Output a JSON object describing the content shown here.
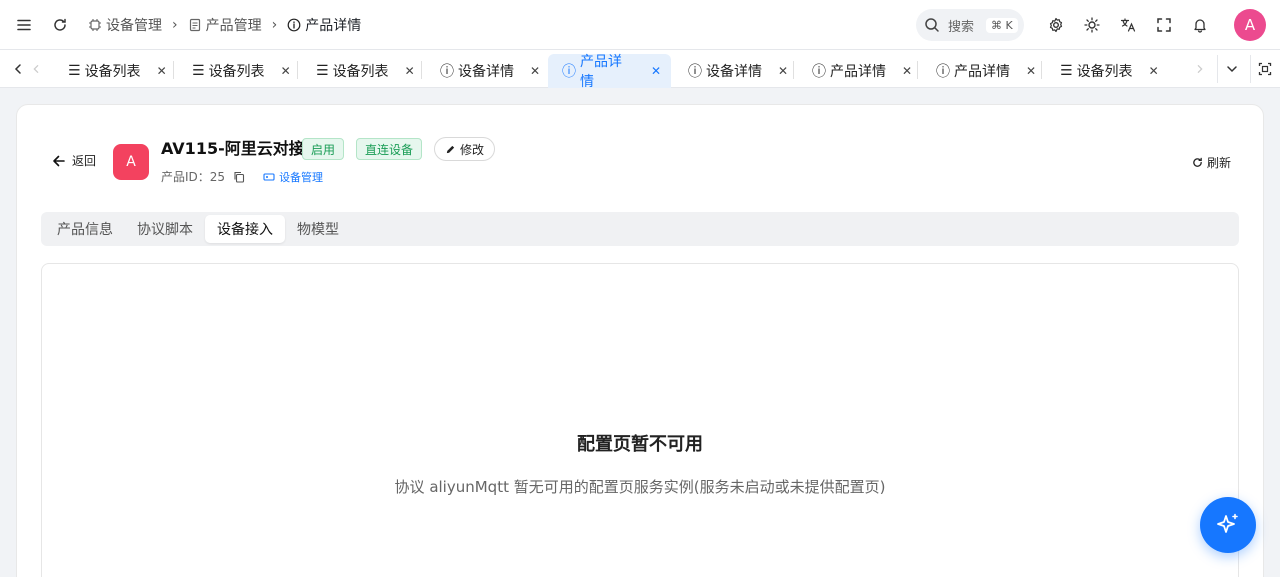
{
  "breadcrumb": [
    {
      "label": "设备管理",
      "icon": "chip-icon"
    },
    {
      "label": "产品管理",
      "icon": "document-icon"
    },
    {
      "label": "产品详情",
      "icon": "info-icon"
    }
  ],
  "search": {
    "label": "搜索",
    "shortcut": "⌘ K"
  },
  "user": {
    "avatar_letter": "A"
  },
  "tabs": [
    {
      "label": "设备列表",
      "icon": "list-icon",
      "active": false
    },
    {
      "label": "设备列表",
      "icon": "list-icon",
      "active": false
    },
    {
      "label": "设备列表",
      "icon": "list-icon",
      "active": false
    },
    {
      "label": "设备详情",
      "icon": "info-icon",
      "active": false
    },
    {
      "label": "产品详情",
      "icon": "info-icon",
      "active": true
    },
    {
      "label": "设备详情",
      "icon": "info-icon",
      "active": false
    },
    {
      "label": "产品详情",
      "icon": "info-icon",
      "active": false
    },
    {
      "label": "产品详情",
      "icon": "info-icon",
      "active": false
    },
    {
      "label": "设备列表",
      "icon": "list-icon",
      "active": false
    }
  ],
  "header": {
    "back_label": "返回",
    "product_avatar": "A",
    "title": "AV115-阿里云对接",
    "status_badge": "启用",
    "type_badge": "直连设备",
    "edit_label": "修改",
    "product_id_label": "产品ID：25",
    "device_link": "设备管理",
    "refresh_label": "刷新"
  },
  "subtabs": [
    {
      "label": "产品信息",
      "active": false
    },
    {
      "label": "协议脚本",
      "active": false
    },
    {
      "label": "设备接入",
      "active": true
    },
    {
      "label": "物模型",
      "active": false
    }
  ],
  "empty": {
    "title": "配置页暂不可用",
    "description": "协议 aliyunMqtt 暂无可用的配置页服务实例(服务未启动或未提供配置页)"
  },
  "colors": {
    "accent": "#1677ff",
    "avatar": "#ec4a8f",
    "product_avatar": "#f3425f",
    "success": "#1a9d56"
  }
}
